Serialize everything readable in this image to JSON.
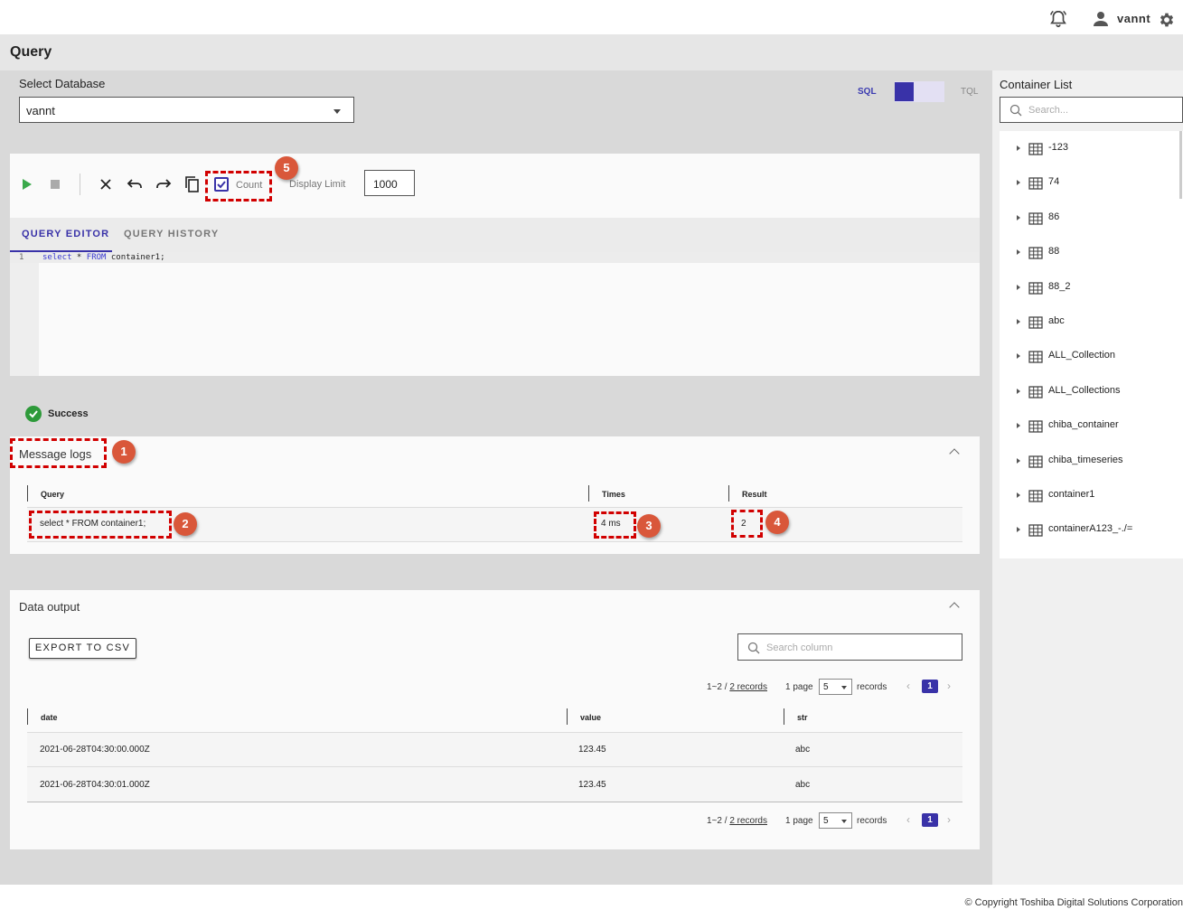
{
  "header": {
    "username": "vannt",
    "icons": {
      "notification": "bell-icon",
      "user": "user-icon",
      "settings": "gear-icon"
    }
  },
  "page": {
    "title": "Query"
  },
  "database": {
    "label": "Select Database",
    "selected": "vannt"
  },
  "mode_toggle": {
    "left": "SQL",
    "right": "TQL",
    "active": "SQL"
  },
  "toolbar": {
    "count_label": "Count",
    "count_checked": true,
    "display_limit_label": "Display Limit",
    "display_limit_value": "1000"
  },
  "tabs": [
    {
      "label": "QUERY EDITOR",
      "active": true
    },
    {
      "label": "QUERY HISTORY",
      "active": false
    }
  ],
  "editor": {
    "line_number": "1",
    "kw1": "select",
    "mid1": " * ",
    "kw2": "FROM",
    "rest": " container1;"
  },
  "status": {
    "text": "Success"
  },
  "message_logs": {
    "title": "Message logs",
    "columns": [
      "Query",
      "Times",
      "Result"
    ],
    "rows": [
      {
        "query": "select * FROM container1;",
        "times": "4 ms",
        "result": "2"
      }
    ]
  },
  "annotations": [
    "1",
    "2",
    "3",
    "4",
    "5"
  ],
  "data_output": {
    "title": "Data output",
    "export_label": "EXPORT TO CSV",
    "search_placeholder": "Search column",
    "pagination": {
      "range": "1~2 / ",
      "records_link": "2 records",
      "page_label": "1 page",
      "page_size": "5",
      "records_label": "records",
      "current_page": "1"
    },
    "columns": [
      "date",
      "value",
      "str"
    ],
    "rows": [
      {
        "date": "2021-06-28T04:30:00.000Z",
        "value": "123.45",
        "str": "abc"
      },
      {
        "date": "2021-06-28T04:30:01.000Z",
        "value": "123.45",
        "str": "abc"
      }
    ]
  },
  "container_list": {
    "title": "Container List",
    "search_placeholder": "Search...",
    "items": [
      "-123",
      "74",
      "86",
      "88",
      "88_2",
      "abc",
      "ALL_Collection",
      "ALL_Collections",
      "chiba_container",
      "chiba_timeseries",
      "container1",
      "containerA123_-./="
    ]
  },
  "footer": {
    "copyright": "© Copyright Toshiba Digital Solutions Corporation"
  },
  "colors": {
    "accent": "#3932a8",
    "success": "#2e9a3a",
    "highlight": "#d10000",
    "badge": "#d9573a"
  }
}
